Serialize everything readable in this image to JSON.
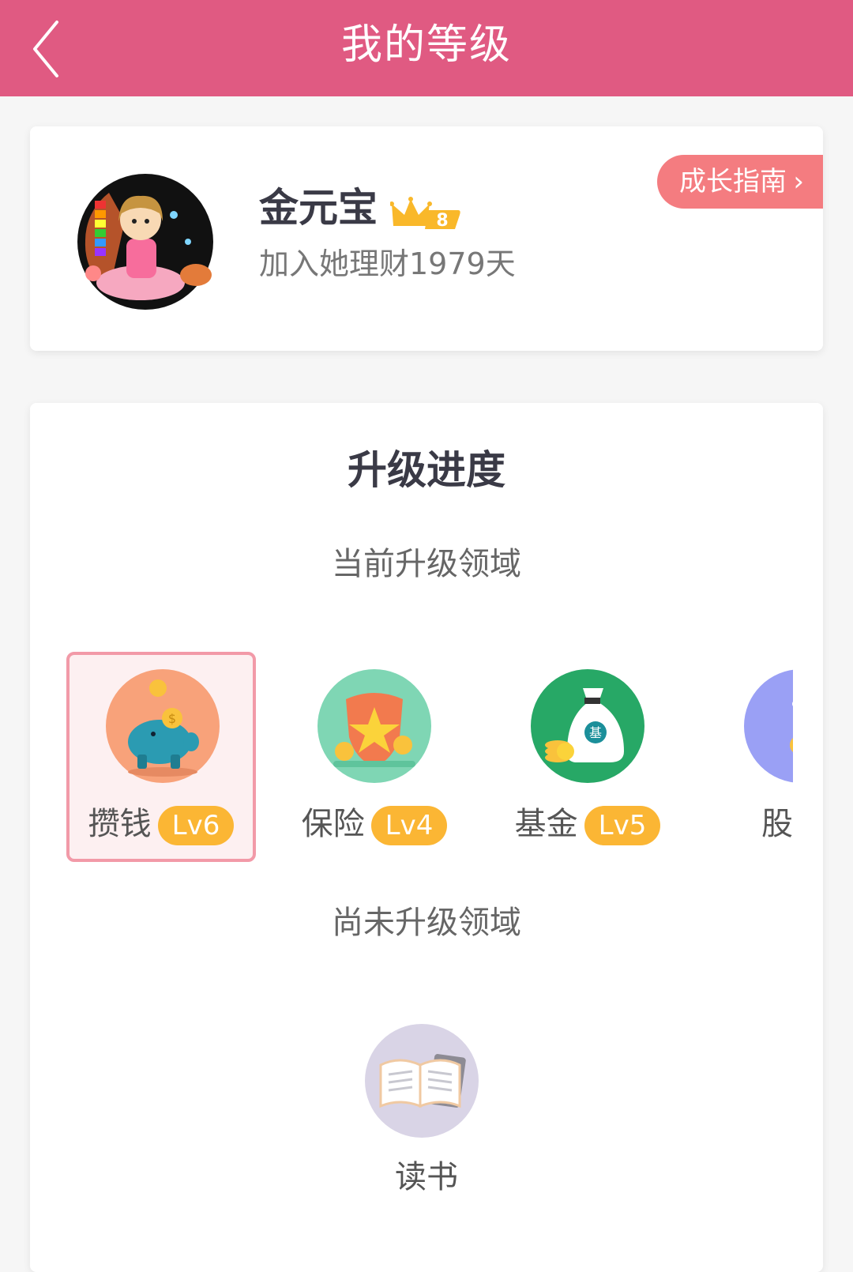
{
  "header": {
    "title": "我的等级"
  },
  "profile": {
    "name": "金元宝",
    "level_badge": "8",
    "join_text": "加入她理财1979天",
    "guide_label": "成长指南",
    "guide_arrow": "›"
  },
  "progress": {
    "title": "升级进度",
    "current_title": "当前升级领域",
    "current_domains": [
      {
        "name": "攒钱",
        "level": "Lv6",
        "icon": "piggy-bank-icon",
        "color": "#f8a27a"
      },
      {
        "name": "保险",
        "level": "Lv4",
        "icon": "shield-icon",
        "color": "#7fd6b4"
      },
      {
        "name": "基金",
        "level": "Lv5",
        "icon": "money-bag-icon",
        "color": "#27a866"
      },
      {
        "name": "股票",
        "level": "",
        "icon": "stock-icon",
        "color": "#9aa0f5"
      }
    ],
    "pending_title": "尚未升级领域",
    "pending_domains": [
      {
        "name": "读书",
        "icon": "book-icon",
        "color": "#d9d4e6"
      }
    ]
  },
  "colors": {
    "accent": "#e05a82",
    "badge": "#fbb634",
    "guide": "#f47c80"
  }
}
